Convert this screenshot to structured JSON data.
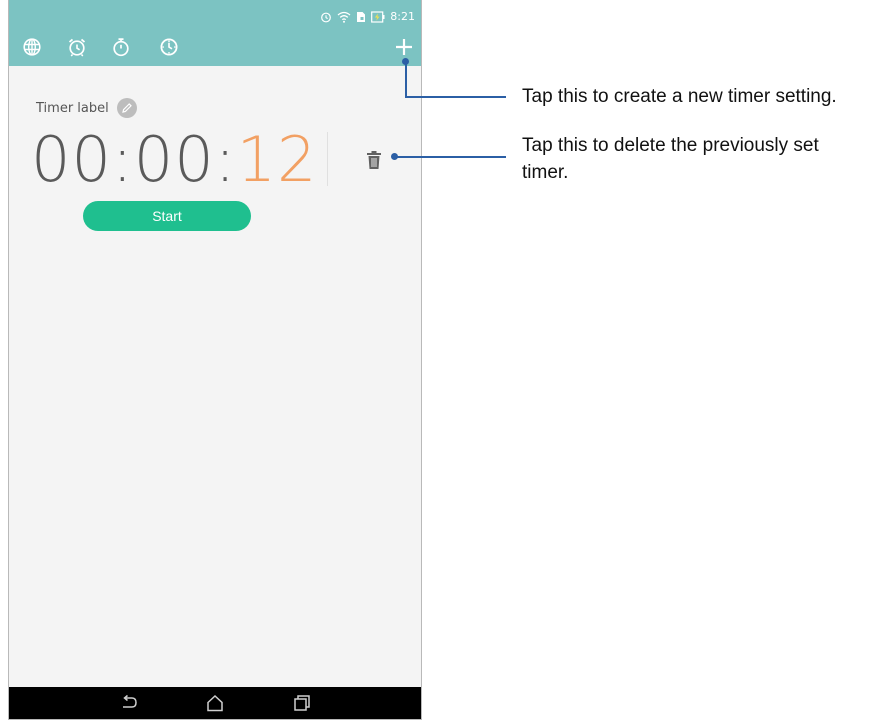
{
  "status_bar": {
    "time": "8:21"
  },
  "toolbar": {
    "tabs": [
      {
        "icon": "globe-icon"
      },
      {
        "icon": "alarm-icon"
      },
      {
        "icon": "stopwatch-icon"
      },
      {
        "icon": "timer-icon"
      }
    ],
    "add_icon": "plus-icon"
  },
  "timer": {
    "label": "Timer label",
    "digits_main": "00:00:",
    "digits_seconds": "12",
    "start_label": "Start"
  },
  "callouts": {
    "add": "Tap this to create a new timer setting.",
    "delete": "Tap this to delete the previously set timer."
  },
  "colors": {
    "accent_bar": "#7cc3c2",
    "start_button": "#1fbf8f",
    "seconds": "#f2a063",
    "callout_line": "#2b5fa5"
  }
}
